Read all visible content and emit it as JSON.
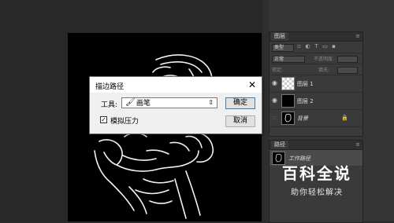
{
  "dialog": {
    "title": "描边路径",
    "close_glyph": "✕",
    "tool_label": "工具:",
    "tool_value": "画笔",
    "tool_icon": "brush-icon",
    "confirm_label": "确定",
    "cancel_label": "取消",
    "simulate_pressure_label": "模拟压力",
    "simulate_pressure_checked": true
  },
  "layers_panel": {
    "tab_label": "图层",
    "kind_filter": "类型",
    "blend_mode": "正常",
    "opacity_label": "不透明度:",
    "lock_label": "锁定:",
    "fill_label": "填充:",
    "layers": [
      {
        "name": "图层 1",
        "thumb": "transparent",
        "visible": true,
        "selected": false
      },
      {
        "name": "图层 2",
        "thumb": "black",
        "visible": true,
        "selected": false
      },
      {
        "name": "背景",
        "thumb": "fist",
        "visible": false,
        "selected": false,
        "locked": true
      }
    ]
  },
  "paths_panel": {
    "tab_label": "路径",
    "paths": [
      {
        "name": "工作路径"
      }
    ]
  },
  "watermark": {
    "title": "百科全说",
    "subtitle": "助你轻松解决"
  }
}
